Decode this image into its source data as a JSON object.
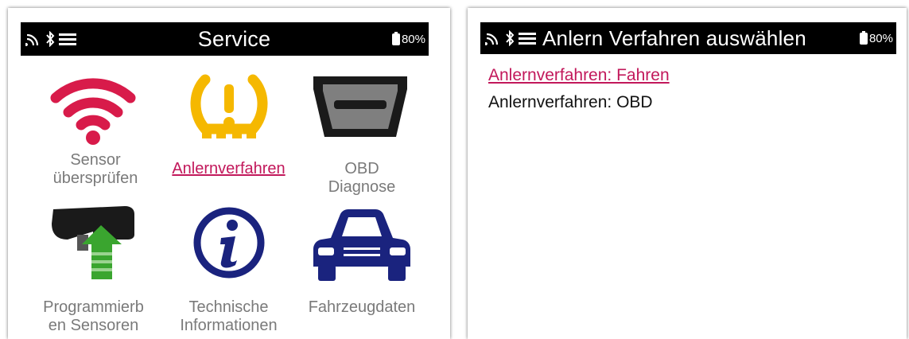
{
  "left_screen": {
    "statusbar": {
      "title": "Service",
      "battery": "80%"
    },
    "tiles": [
      {
        "id": "sensor",
        "label_line1": "Sensor",
        "label_line2": "übersprüfen",
        "icon": "wifi-icon"
      },
      {
        "id": "relearn",
        "label_line1": "Anlernverfahren",
        "label_line2": "",
        "icon": "tpms-warning-icon",
        "active": true
      },
      {
        "id": "obd",
        "label_line1": "OBD",
        "label_line2": "Diagnose",
        "icon": "obd-connector-icon"
      },
      {
        "id": "program",
        "label_line1": "Programmierb",
        "label_line2": "en Sensoren",
        "icon": "sensor-program-icon"
      },
      {
        "id": "info",
        "label_line1": "Technische",
        "label_line2": "Informationen",
        "icon": "info-icon"
      },
      {
        "id": "vehicle",
        "label_line1": "Fahrzeugdaten",
        "label_line2": "",
        "icon": "car-icon"
      }
    ]
  },
  "right_screen": {
    "statusbar": {
      "title": "Anlern Verfahren auswählen",
      "battery": "80%"
    },
    "options": [
      {
        "label": "Anlernverfahren: Fahren",
        "active": true
      },
      {
        "label": "Anlernverfahren: OBD",
        "active": false
      }
    ]
  },
  "colors": {
    "accent": "#c2185b",
    "tpms_yellow": "#f5b800",
    "wifi_red": "#d81b4a",
    "info_navy": "#1a237e",
    "arrow_green": "#3aa52f",
    "label_gray": "#7a7a7a"
  }
}
